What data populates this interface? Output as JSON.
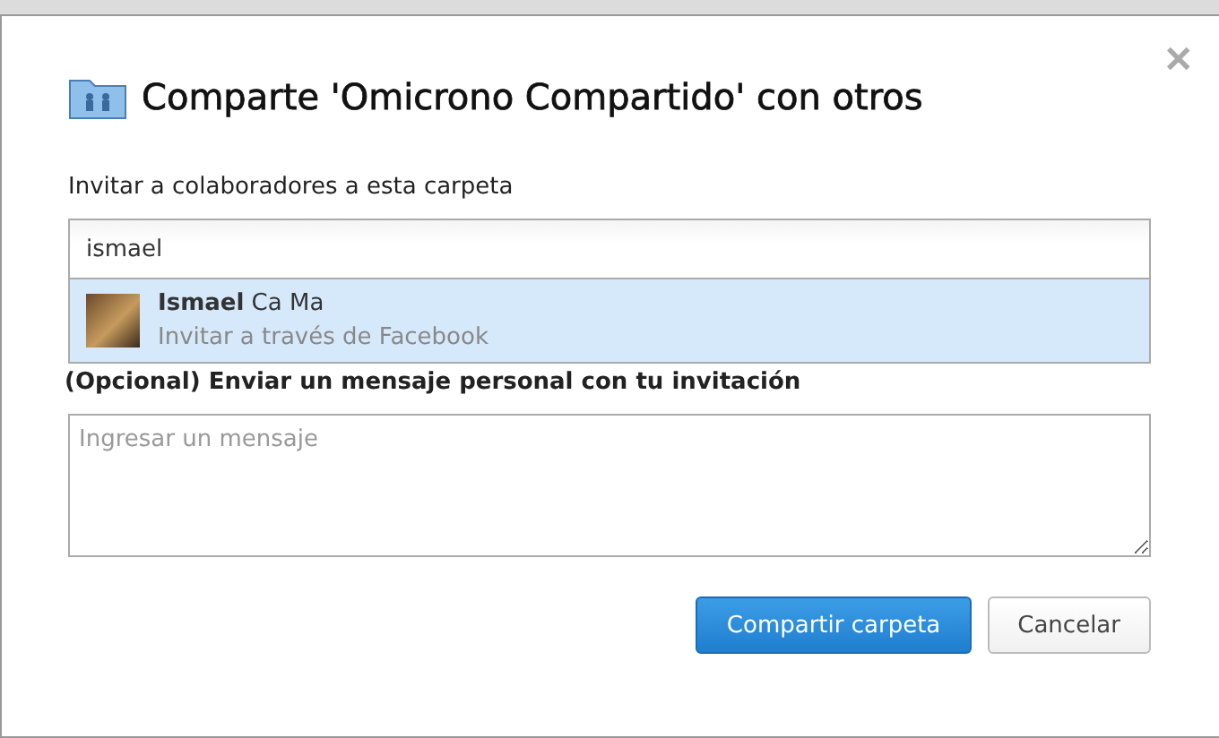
{
  "dialog": {
    "title": "Comparte 'Omicrono Compartido' con otros",
    "close": "✕",
    "invite_label": "Invitar a colaboradores a esta carpeta",
    "invite_field": {
      "value": "ismael"
    },
    "suggestions": [
      {
        "name": "**Ismael** Ca Ma",
        "detail": "Invitar a través de Facebook",
        "selected": true
      }
    ],
    "message_label": "(Opcional) Enviar un mensaje personal con tu invitación",
    "message_field": {
      "placeholder": "Ingresar un mensaje"
    },
    "buttons": [
      {
        "label": "Compartir carpeta",
        "kind": "primary"
      },
      {
        "label": "Cancelar",
        "kind": "secondary"
      }
    ]
  }
}
